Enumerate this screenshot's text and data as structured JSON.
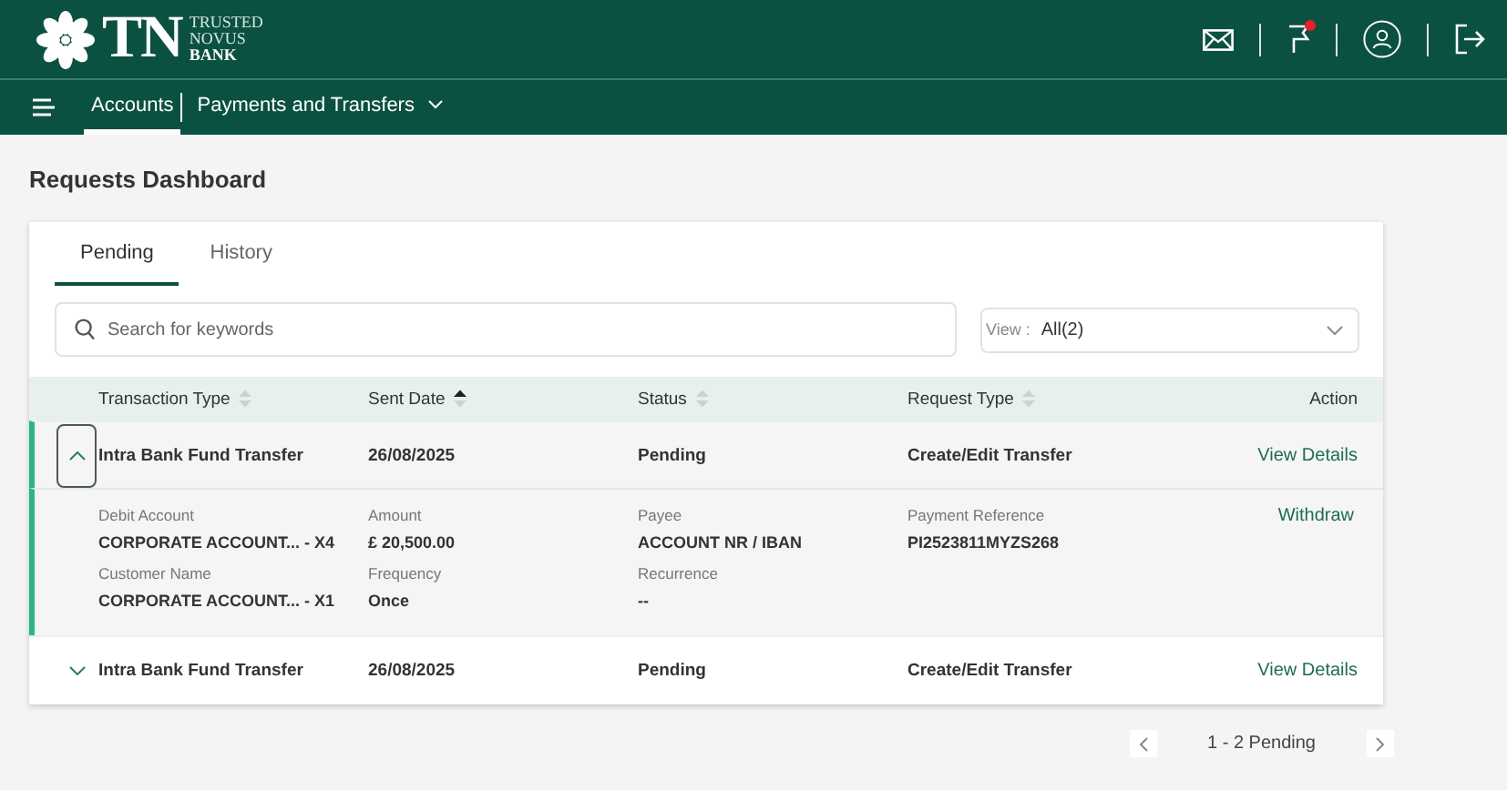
{
  "header": {
    "logo": {
      "mark": "TN",
      "tagline_lines": [
        "TRUSTED",
        "NOVUS",
        "BANK"
      ]
    },
    "flag_alert": true
  },
  "nav": {
    "items": [
      {
        "label": "Accounts",
        "selected": true,
        "has_menu": false
      },
      {
        "label": "Payments and Transfers",
        "selected": false,
        "has_menu": true
      }
    ]
  },
  "page_title": "Requests Dashboard",
  "tabs": [
    {
      "label": "Pending",
      "selected": true
    },
    {
      "label": "History",
      "selected": false
    }
  ],
  "search": {
    "placeholder": "Search for keywords"
  },
  "view_filter": {
    "label": "View :",
    "value": "All(2)"
  },
  "table": {
    "columns": [
      {
        "label": "Transaction Type",
        "sortable": true,
        "sorted_ascending": false
      },
      {
        "label": "Sent Date",
        "sortable": true,
        "sorted_ascending": true
      },
      {
        "label": "Status",
        "sortable": true,
        "sorted_ascending": false
      },
      {
        "label": "Request Type",
        "sortable": true,
        "sorted_ascending": false
      },
      {
        "label": "Action",
        "sortable": false
      }
    ],
    "rows": [
      {
        "expanded": true,
        "cells": [
          "Intra Bank Fund Transfer",
          "26/08/2025",
          "Pending",
          "Create/Edit Transfer"
        ],
        "action": "View Details",
        "details": [
          {
            "label": "Debit Account",
            "value": "CORPORATE ACCOUNT... - X4"
          },
          {
            "label": "Amount",
            "value": "£ 20,500.00"
          },
          {
            "label": "Payee",
            "value": "ACCOUNT NR / IBAN"
          },
          {
            "label": "Payment Reference",
            "value": "PI2523811MYZS268"
          },
          {
            "label": "Customer Name",
            "value": "CORPORATE ACCOUNT... - X1"
          },
          {
            "label": "Frequency",
            "value": "Once"
          },
          {
            "label": "Recurrence",
            "value": "--"
          }
        ],
        "detail_action": "Withdraw"
      },
      {
        "expanded": false,
        "cells": [
          "Intra Bank Fund Transfer",
          "26/08/2025",
          "Pending",
          "Create/Edit Transfer"
        ],
        "action": "View Details"
      }
    ]
  },
  "pagination": {
    "summary": "1 - 2 Pending"
  }
}
